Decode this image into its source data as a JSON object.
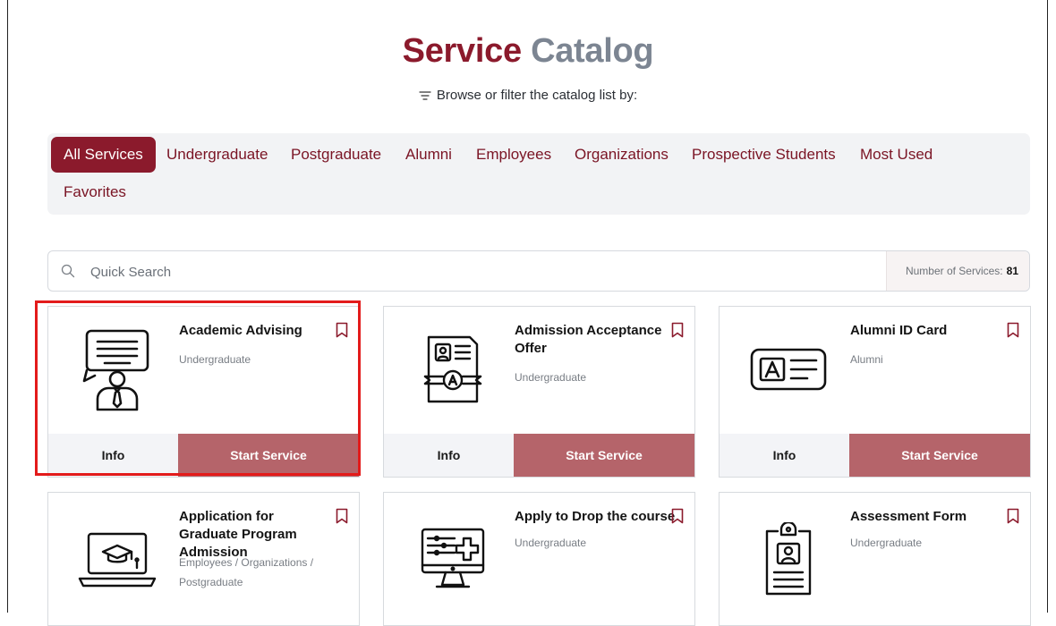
{
  "header": {
    "title_part1": "Service",
    "title_part2": "Catalog",
    "subtitle": "Browse or filter the catalog list by:"
  },
  "filters": [
    {
      "label": "All Services",
      "active": true
    },
    {
      "label": "Undergraduate"
    },
    {
      "label": "Postgraduate"
    },
    {
      "label": "Alumni"
    },
    {
      "label": "Employees"
    },
    {
      "label": "Organizations"
    },
    {
      "label": "Prospective Students"
    },
    {
      "label": "Most Used"
    },
    {
      "label": "Favorites"
    }
  ],
  "search": {
    "placeholder": "Quick Search",
    "count_label": "Number of Services:",
    "count_value": "81"
  },
  "cards": [
    {
      "name": "Academic Advising",
      "category": "Undergraduate",
      "icon": "advisor-presentation-icon",
      "info_label": "Info",
      "start_label": "Start Service"
    },
    {
      "name": "Admission Acceptance Offer",
      "category": "Undergraduate",
      "icon": "certificate-icon",
      "info_label": "Info",
      "start_label": "Start Service"
    },
    {
      "name": "Alumni ID Card",
      "category": "Alumni",
      "icon": "id-card-icon",
      "info_label": "Info",
      "start_label": "Start Service"
    },
    {
      "name": "Application for Graduate Program Admission",
      "category": "Employees / Organizations / Postgraduate",
      "icon": "laptop-graduation-icon"
    },
    {
      "name": "Apply to Drop the course",
      "category": "Undergraduate",
      "icon": "monitor-form-icon"
    },
    {
      "name": "Assessment Form",
      "category": "Undergraduate",
      "icon": "clipboard-badge-icon"
    }
  ],
  "colors": {
    "brand": "#8b1a2c",
    "title_gray": "#7c8592",
    "start_button": "#b5646a",
    "highlight": "#e31b1b"
  }
}
